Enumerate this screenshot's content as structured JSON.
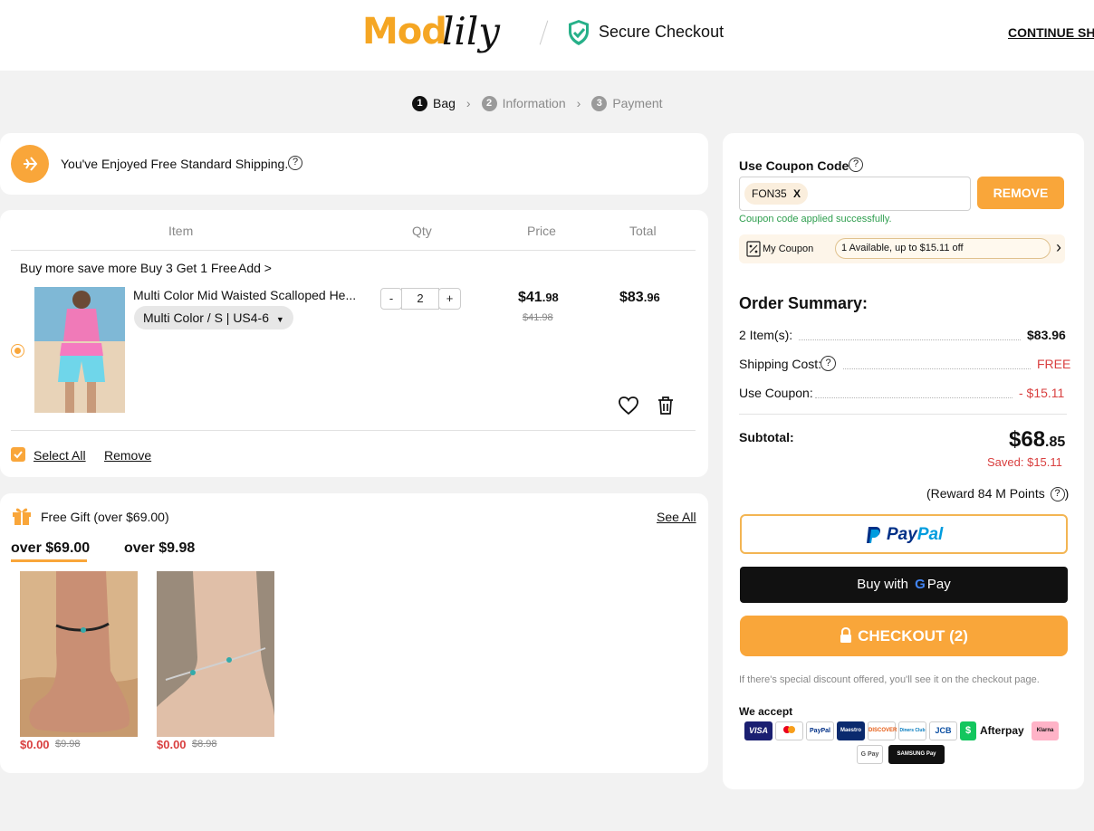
{
  "header": {
    "logo_mod": "Mod",
    "logo_lily": "lily",
    "secure_label": "Secure Checkout",
    "continue_label": "CONTINUE SHOPPING"
  },
  "steps": [
    {
      "num": "1",
      "label": "Bag"
    },
    {
      "num": "2",
      "label": "Information"
    },
    {
      "num": "3",
      "label": "Payment"
    }
  ],
  "shipping_banner": {
    "text": "You've Enjoyed Free Standard Shipping.",
    "help": "?"
  },
  "cart": {
    "columns": {
      "item": "Item",
      "qty": "Qty",
      "price": "Price",
      "total": "Total"
    },
    "promo": {
      "text": "Buy more save more Buy 3 Get 1 Free",
      "action": "Add >"
    },
    "product": {
      "name": "Multi Color Mid Waisted Scalloped He...",
      "variant": "Multi Color / S | US4-6",
      "qty_minus": "-",
      "qty": "2",
      "qty_plus": "+",
      "price_main": "$41",
      "price_cents": ".98",
      "price_orig": "$41.98",
      "total_main": "$83",
      "total_cents": ".96"
    },
    "select_all": "Select All",
    "remove": "Remove"
  },
  "gifts": {
    "title": "Free Gift (over $69.00)",
    "see_all": "See All",
    "tabs": [
      "over $69.00",
      "over $9.98"
    ],
    "items": [
      {
        "price": "$0.00",
        "orig": "$9.98"
      },
      {
        "price": "$0.00",
        "orig": "$8.98"
      }
    ]
  },
  "coupon": {
    "title": "Use Coupon Code",
    "help": "?",
    "code": "FON35",
    "code_clear": "X",
    "remove_btn": "REMOVE",
    "success": "Coupon code applied successfully.",
    "my_coupon": "My Coupon",
    "available": "1 Available, up to $15.11 off"
  },
  "summary": {
    "title": "Order Summary:",
    "rows": [
      {
        "label": "2 Item(s):",
        "value": "$83.96"
      },
      {
        "label": "Shipping Cost:",
        "value": "FREE"
      },
      {
        "label": "Use Coupon:",
        "value": "- $15.11"
      }
    ],
    "subtotal_label": "Subtotal:",
    "subtotal_main": "$68",
    "subtotal_cents": ".85",
    "saved": "Saved: $15.11",
    "reward": "(Reward 84 M Points",
    "reward_close": ")"
  },
  "buttons": {
    "paypal_1": "Pay",
    "paypal_2": "Pal",
    "gpay_prefix": "Buy with",
    "gpay_g": "G",
    "gpay_pay": "Pay",
    "checkout": "CHECKOUT (2)"
  },
  "discount_note": "If there's special discount offered, you'll see it on the checkout page.",
  "we_accept": "We accept",
  "payment_methods": [
    "VISA",
    "Mastercard",
    "PayPal",
    "Maestro",
    "DISCOVER",
    "Diners Club",
    "JCB",
    "Afterpay",
    "Klarna",
    "G Pay",
    "SAMSUNG Pay"
  ],
  "colors": {
    "accent": "#f9a63a",
    "red": "#d94040",
    "success": "#2e9e4e",
    "dark": "#111111"
  }
}
